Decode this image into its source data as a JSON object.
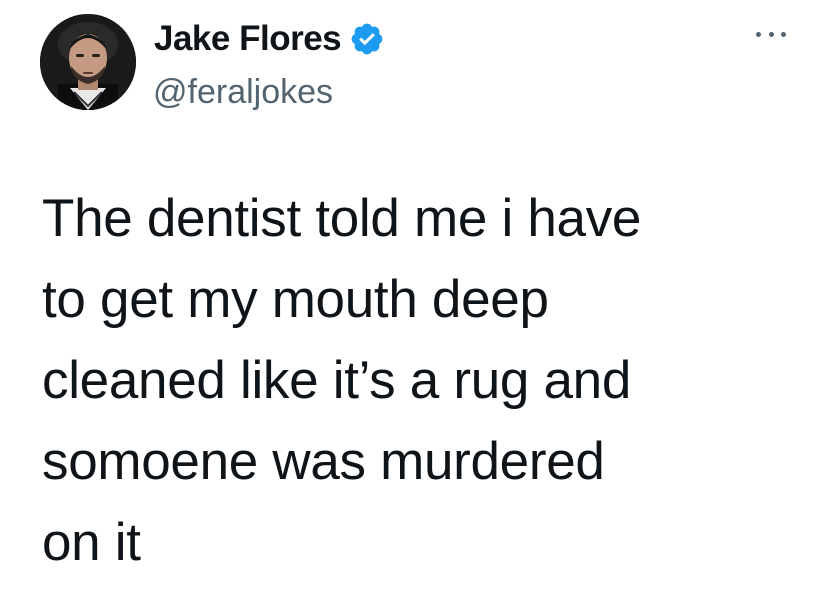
{
  "author": {
    "name": "Jake Flores",
    "handle": "@feraljokes",
    "verified": true
  },
  "tweet": {
    "lines": [
      "The dentist told me i have",
      "to get my mouth deep",
      "cleaned like it’s a rug and",
      "somoene was murdered",
      "on it"
    ]
  },
  "icons": {
    "verified": "verified-badge-icon",
    "more": "more-options-icon"
  },
  "colors": {
    "text": "#0f1419",
    "secondary": "#536471",
    "verified": "#1d9bf0",
    "background": "#ffffff"
  }
}
